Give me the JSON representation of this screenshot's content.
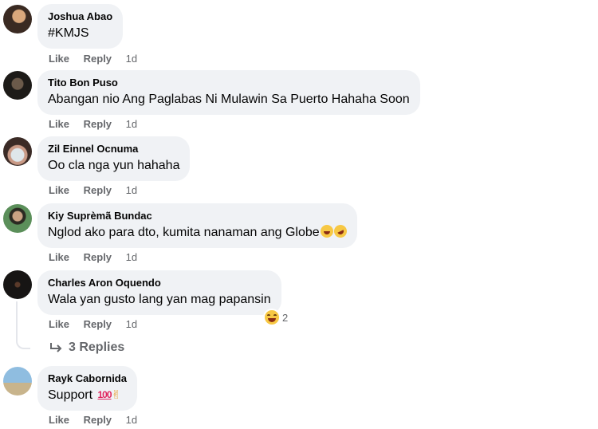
{
  "comments": [
    {
      "author": "Joshua Abao",
      "text": "#KMJS",
      "like": "Like",
      "reply": "Reply",
      "time": "1d",
      "avatar": "avatar-photo"
    },
    {
      "author": "Tito Bon Puso",
      "text": "Abangan nio Ang Paglabas Ni Mulawin Sa Puerto Hahaha Soon",
      "like": "Like",
      "reply": "Reply",
      "time": "1d",
      "avatar": "avatar-photo"
    },
    {
      "author": "Zil Einnel Ocnuma",
      "text": "Oo cla nga yun hahaha",
      "like": "Like",
      "reply": "Reply",
      "time": "1d",
      "avatar": "avatar-photo"
    },
    {
      "author": "Kiy Suprèmã Bundac",
      "text": "Nglod ako para dto, kumita nanaman ang Globe",
      "like": "Like",
      "reply": "Reply",
      "time": "1d",
      "avatar": "avatar-photo",
      "emojis": [
        "laughing-tears-icon",
        "rolling-laugh-icon"
      ]
    },
    {
      "author": "Charles Aron Oquendo",
      "text": "Wala yan gusto lang yan mag papansin",
      "like": "Like",
      "reply": "Reply",
      "time": "1d",
      "avatar": "avatar-photo",
      "reaction_count": "2",
      "reaction_icon": "haha-reaction-icon"
    },
    {
      "author": "Rayk Cabornida",
      "text": "Support",
      "like": "Like",
      "reply": "Reply",
      "time": "1d",
      "avatar": "avatar-photo",
      "emojis": [
        "hundred-points-icon",
        "victory-hand-icon"
      ]
    }
  ],
  "replies_link": {
    "label": "3 Replies",
    "icon": "reply-arrow-icon"
  },
  "colors": {
    "bubble": "#f0f2f5",
    "meta": "#65676b",
    "text": "#050505"
  }
}
